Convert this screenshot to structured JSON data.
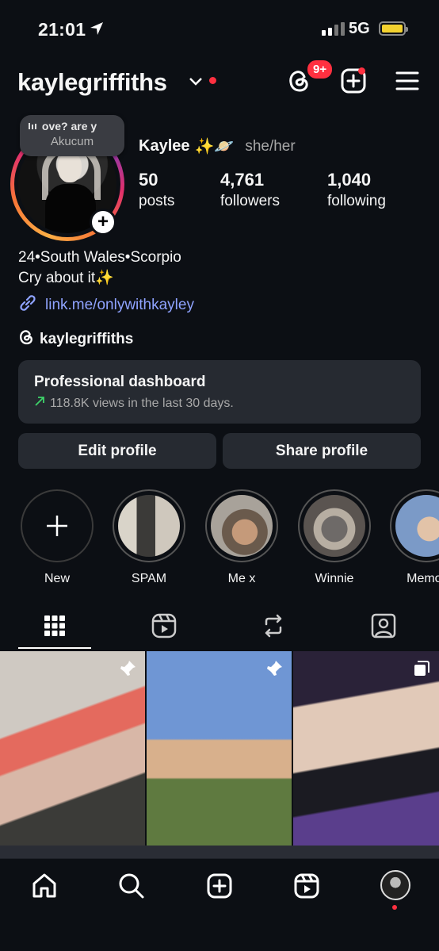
{
  "status_bar": {
    "time": "21:01",
    "network": "5G"
  },
  "header": {
    "username": "kaylegriffiths",
    "notification_badge": "9+",
    "icons": [
      "threads-icon",
      "new-post-icon",
      "menu-icon"
    ]
  },
  "note": {
    "text": "ove? are y",
    "author": "Akucum"
  },
  "profile": {
    "display_name": "Kaylee",
    "emoji": "✨🪐",
    "pronouns": "she/her",
    "stats": [
      {
        "value": "50",
        "label": "posts"
      },
      {
        "value": "4,761",
        "label": "followers"
      },
      {
        "value": "1,040",
        "label": "following"
      }
    ],
    "bio_line1": "24•South Wales•Scorpio",
    "bio_line2": "Cry about it✨",
    "link": "link.me/onlywithkayley",
    "threads_handle": "kaylegriffiths"
  },
  "dashboard": {
    "title": "Professional dashboard",
    "subtitle": "118.8K views in the last 30 days."
  },
  "buttons": {
    "edit": "Edit profile",
    "share": "Share profile"
  },
  "highlights": [
    {
      "label": "New"
    },
    {
      "label": "SPAM"
    },
    {
      "label": "Me x"
    },
    {
      "label": "Winnie"
    },
    {
      "label": "Memor"
    }
  ],
  "tabs": [
    "grid-icon",
    "reels-icon",
    "reposts-icon",
    "tagged-icon"
  ],
  "nav": [
    "home-icon",
    "search-icon",
    "create-icon",
    "reels-icon",
    "profile-avatar"
  ],
  "colors": {
    "accent_red": "#ff3040",
    "link_blue": "#8fa3ff",
    "card_bg": "#262a31"
  }
}
